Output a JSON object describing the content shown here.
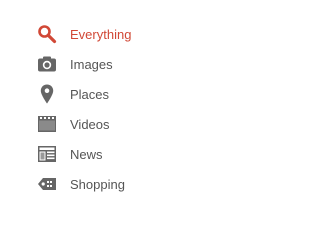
{
  "colors": {
    "active": "#d14836",
    "text": "#555555",
    "icon": "#666666"
  },
  "nav": {
    "items": [
      {
        "label": "Everything",
        "icon": "search-icon",
        "active": true
      },
      {
        "label": "Images",
        "icon": "camera-icon",
        "active": false
      },
      {
        "label": "Places",
        "icon": "map-pin-icon",
        "active": false
      },
      {
        "label": "Videos",
        "icon": "film-icon",
        "active": false
      },
      {
        "label": "News",
        "icon": "newspaper-icon",
        "active": false
      },
      {
        "label": "Shopping",
        "icon": "price-tag-icon",
        "active": false
      }
    ]
  }
}
